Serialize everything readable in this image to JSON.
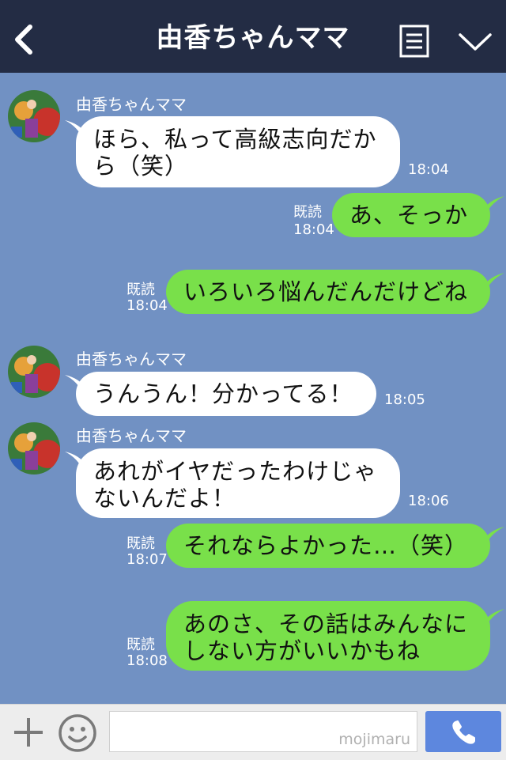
{
  "header": {
    "title": "由香ちゃんママ",
    "icons": [
      "back-arrow-icon",
      "menu-list-icon",
      "chevron-down-icon"
    ],
    "background": "#232c44"
  },
  "colors": {
    "chat_background": "#7191c3",
    "outgoing_bubble": "#79e04a",
    "incoming_bubble": "#ffffff",
    "send_button": "#5d87de"
  },
  "messages": [
    {
      "direction": "in",
      "sender": "由香ちゃんママ",
      "lines": [
        "ほら、私って高級志向だか",
        "ら（笑）"
      ],
      "time": "18:04"
    },
    {
      "direction": "out",
      "read": "既読",
      "lines": [
        "あ、そっか"
      ],
      "time": "18:04"
    },
    {
      "direction": "out",
      "read": "既読",
      "lines": [
        "いろいろ悩んだんだけどね"
      ],
      "time": "18:04"
    },
    {
      "direction": "in",
      "sender": "由香ちゃんママ",
      "lines": [
        "うんうん！分かってる！"
      ],
      "time": "18:05"
    },
    {
      "direction": "in",
      "sender": "由香ちゃんママ",
      "lines": [
        "あれがイヤだったわけじゃ",
        "ないんだよ！"
      ],
      "time": "18:06"
    },
    {
      "direction": "out",
      "read": "既読",
      "lines": [
        "それならよかった…（笑）"
      ],
      "time": "18:07"
    },
    {
      "direction": "out",
      "read": "既読",
      "lines": [
        "あのさ、その話はみんなに",
        "しない方がいいかもね"
      ],
      "time": "18:08"
    }
  ],
  "footer": {
    "watermark": "mojimaru",
    "icons": [
      "plus-icon",
      "smiley-icon",
      "phone-icon"
    ]
  }
}
